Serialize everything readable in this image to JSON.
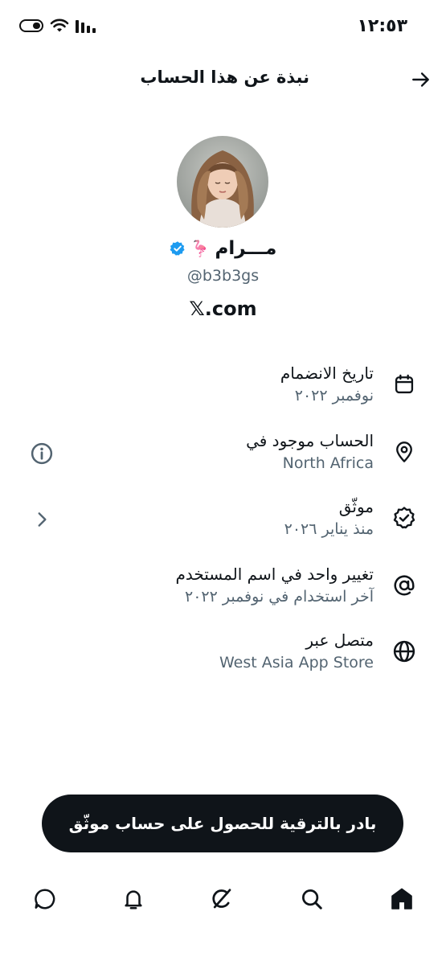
{
  "status_bar": {
    "time": "١٢:٥٣",
    "icons": [
      "battery-icon",
      "wifi-icon",
      "signal-icon"
    ]
  },
  "header": {
    "title": "نبذة عن هذا الحساب",
    "back_icon": "arrow-right-icon"
  },
  "profile": {
    "display_name": "مـــرام",
    "name_emoji": "🦩",
    "verified": true,
    "handle": "@b3b3gs",
    "website": "𝕏.com"
  },
  "info_rows": [
    {
      "icon": "calendar-icon",
      "label": "تاريخ الانضمام",
      "value": "نوفمبر ٢٠٢٢"
    },
    {
      "icon": "location-pin-icon",
      "label": "الحساب موجود في",
      "value": "North Africa",
      "side_icon": "info-icon"
    },
    {
      "icon": "verified-badge-icon",
      "label": "موثّق",
      "value": "منذ يناير ٢٠٢٦",
      "side_icon": "chevron-right-icon"
    },
    {
      "icon": "at-sign-icon",
      "label": "تغيير واحد في اسم المستخدم",
      "value": "آخر استخدام في نوفمبر ٢٠٢٢"
    },
    {
      "icon": "globe-icon",
      "label": "متصل عبر",
      "value": "West Asia App Store"
    }
  ],
  "upgrade_button": {
    "label": "بادر بالترقية للحصول على حساب موثّق"
  },
  "bottom_nav": [
    {
      "name": "home",
      "icon": "home-icon",
      "active": true
    },
    {
      "name": "search",
      "icon": "search-icon"
    },
    {
      "name": "grok",
      "icon": "grok-icon"
    },
    {
      "name": "notifications",
      "icon": "bell-icon"
    },
    {
      "name": "messages",
      "icon": "message-icon"
    }
  ],
  "colors": {
    "text_primary": "#0f1419",
    "text_secondary": "#536471",
    "verified_blue": "#1d9bf0",
    "button_bg": "#0f1419"
  }
}
